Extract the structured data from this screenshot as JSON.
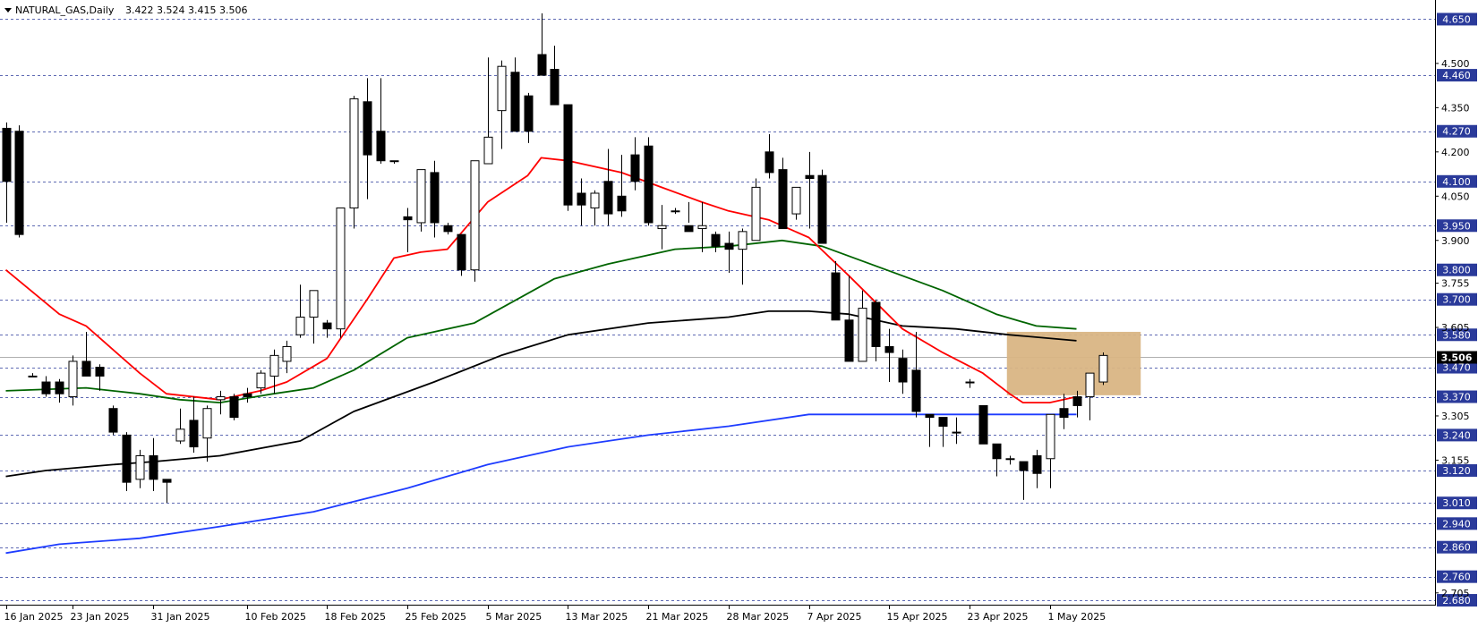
{
  "header": {
    "symbol": "NATURAL_GAS,Daily",
    "ohlc": "3.422 3.524 3.415 3.506",
    "menu_icon": "triangle-down-icon"
  },
  "chart_data": {
    "type": "candlestick",
    "title": "",
    "xlabel": "",
    "ylabel": "",
    "ylim": [
      2.665,
      4.715
    ],
    "grid": "horizontal-dashed",
    "price_levels": [
      4.65,
      4.46,
      4.27,
      4.1,
      3.95,
      3.8,
      3.7,
      3.58,
      3.47,
      3.37,
      3.24,
      3.12,
      3.01,
      2.94,
      2.86,
      2.76,
      2.68
    ],
    "price_ticks": [
      4.5,
      4.35,
      4.2,
      4.05,
      3.9,
      3.755,
      3.605,
      3.305,
      3.155,
      2.705
    ],
    "current_price": "3.506",
    "current_price_value": 3.506,
    "x_labels": [
      {
        "i": 0,
        "label": "16 Jan 2025"
      },
      {
        "i": 5,
        "label": "23 Jan 2025"
      },
      {
        "i": 11,
        "label": "31 Jan 2025"
      },
      {
        "i": 18,
        "label": "10 Feb 2025"
      },
      {
        "i": 24,
        "label": "18 Feb 2025"
      },
      {
        "i": 30,
        "label": "25 Feb 2025"
      },
      {
        "i": 36,
        "label": "5 Mar 2025"
      },
      {
        "i": 42,
        "label": "13 Mar 2025"
      },
      {
        "i": 48,
        "label": "21 Mar 2025"
      },
      {
        "i": 54,
        "label": "28 Mar 2025"
      },
      {
        "i": 60,
        "label": "7 Apr 2025"
      },
      {
        "i": 66,
        "label": "15 Apr 2025"
      },
      {
        "i": 72,
        "label": "23 Apr 2025"
      },
      {
        "i": 78,
        "label": "1 May 2025"
      }
    ],
    "candles": [
      [
        4.28,
        4.3,
        3.96,
        4.1
      ],
      [
        4.27,
        4.29,
        3.91,
        3.92
      ],
      [
        3.44,
        3.45,
        3.44,
        3.44
      ],
      [
        3.42,
        3.44,
        3.37,
        3.38
      ],
      [
        3.42,
        3.43,
        3.35,
        3.38
      ],
      [
        3.37,
        3.51,
        3.34,
        3.49
      ],
      [
        3.49,
        3.59,
        3.44,
        3.44
      ],
      [
        3.47,
        3.48,
        3.39,
        3.44
      ],
      [
        3.33,
        3.34,
        3.24,
        3.25
      ],
      [
        3.24,
        3.25,
        3.05,
        3.08
      ],
      [
        3.09,
        3.19,
        3.06,
        3.17
      ],
      [
        3.17,
        3.23,
        3.05,
        3.09
      ],
      [
        3.09,
        3.09,
        3.01,
        3.08
      ],
      [
        3.22,
        3.33,
        3.21,
        3.26
      ],
      [
        3.29,
        3.37,
        3.18,
        3.2
      ],
      [
        3.23,
        3.34,
        3.15,
        3.33
      ],
      [
        3.36,
        3.39,
        3.31,
        3.37
      ],
      [
        3.37,
        3.38,
        3.29,
        3.3
      ],
      [
        3.38,
        3.4,
        3.35,
        3.37
      ],
      [
        3.4,
        3.46,
        3.38,
        3.45
      ],
      [
        3.44,
        3.53,
        3.38,
        3.51
      ],
      [
        3.49,
        3.56,
        3.45,
        3.54
      ],
      [
        3.58,
        3.75,
        3.57,
        3.64
      ],
      [
        3.64,
        3.71,
        3.55,
        3.73
      ],
      [
        3.62,
        3.63,
        3.57,
        3.6
      ],
      [
        3.6,
        4.01,
        3.57,
        4.01
      ],
      [
        4.01,
        4.39,
        3.94,
        4.38
      ],
      [
        4.37,
        4.45,
        4.04,
        4.19
      ],
      [
        4.27,
        4.45,
        4.16,
        4.17
      ],
      [
        4.17,
        4.17,
        4.16,
        4.17
      ],
      [
        3.98,
        4.01,
        3.86,
        3.97
      ],
      [
        3.96,
        4.14,
        3.93,
        4.14
      ],
      [
        4.13,
        4.17,
        3.91,
        3.96
      ],
      [
        3.95,
        3.96,
        3.92,
        3.93
      ],
      [
        3.92,
        3.92,
        3.78,
        3.8
      ],
      [
        3.8,
        4.17,
        3.76,
        4.17
      ],
      [
        4.16,
        4.52,
        4.17,
        4.25
      ],
      [
        4.34,
        4.51,
        4.21,
        4.49
      ],
      [
        4.47,
        4.52,
        4.31,
        4.27
      ],
      [
        4.39,
        4.4,
        4.23,
        4.27
      ],
      [
        4.53,
        4.67,
        4.46,
        4.46
      ],
      [
        4.48,
        4.56,
        4.36,
        4.36
      ],
      [
        4.36,
        4.36,
        4.0,
        4.02
      ],
      [
        4.06,
        4.11,
        3.95,
        4.02
      ],
      [
        4.01,
        4.07,
        3.95,
        4.06
      ],
      [
        4.1,
        4.21,
        3.95,
        3.99
      ],
      [
        4.05,
        4.19,
        3.98,
        4.0
      ],
      [
        4.19,
        4.25,
        4.07,
        4.1
      ],
      [
        4.22,
        4.25,
        3.95,
        3.96
      ],
      [
        3.94,
        4.02,
        3.87,
        3.95
      ],
      [
        4.0,
        4.01,
        3.99,
        4.0
      ],
      [
        3.95,
        4.03,
        3.96,
        3.93
      ],
      [
        3.94,
        4.03,
        3.86,
        3.95
      ],
      [
        3.92,
        3.93,
        3.86,
        3.88
      ],
      [
        3.89,
        3.93,
        3.79,
        3.87
      ],
      [
        3.87,
        3.94,
        3.75,
        3.93
      ],
      [
        3.9,
        4.11,
        3.9,
        4.08
      ],
      [
        4.2,
        4.26,
        4.11,
        4.13
      ],
      [
        4.14,
        4.18,
        3.96,
        3.94
      ],
      [
        3.99,
        4.08,
        3.97,
        4.08
      ],
      [
        4.12,
        4.2,
        3.94,
        4.11
      ],
      [
        4.12,
        4.14,
        3.94,
        3.89
      ],
      [
        3.79,
        3.83,
        3.63,
        3.63
      ],
      [
        3.63,
        3.78,
        3.5,
        3.49
      ],
      [
        3.49,
        3.73,
        3.52,
        3.67
      ],
      [
        3.69,
        3.7,
        3.49,
        3.54
      ],
      [
        3.54,
        3.6,
        3.42,
        3.52
      ],
      [
        3.5,
        3.53,
        3.38,
        3.42
      ],
      [
        3.46,
        3.59,
        3.3,
        3.32
      ],
      [
        3.31,
        3.31,
        3.2,
        3.3
      ],
      [
        3.3,
        3.3,
        3.2,
        3.27
      ],
      [
        3.25,
        3.3,
        3.21,
        3.25
      ],
      [
        3.42,
        3.43,
        3.4,
        3.42
      ],
      [
        3.34,
        3.34,
        3.21,
        3.21
      ],
      [
        3.21,
        3.21,
        3.1,
        3.16
      ],
      [
        3.16,
        3.17,
        3.14,
        3.16
      ],
      [
        3.15,
        3.15,
        3.02,
        3.12
      ],
      [
        3.17,
        3.19,
        3.06,
        3.11
      ],
      [
        3.16,
        3.31,
        3.06,
        3.31
      ],
      [
        3.33,
        3.38,
        3.26,
        3.3
      ],
      [
        3.37,
        3.39,
        3.3,
        3.34
      ],
      [
        3.37,
        3.44,
        3.29,
        3.45
      ],
      [
        3.42,
        3.52,
        3.41,
        3.51
      ]
    ],
    "ma_red": [
      [
        0,
        3.8
      ],
      [
        4,
        3.65
      ],
      [
        6,
        3.61
      ],
      [
        10,
        3.45
      ],
      [
        12,
        3.38
      ],
      [
        16,
        3.36
      ],
      [
        19,
        3.39
      ],
      [
        21,
        3.42
      ],
      [
        24,
        3.5
      ],
      [
        27,
        3.7
      ],
      [
        29,
        3.84
      ],
      [
        31,
        3.86
      ],
      [
        33,
        3.87
      ],
      [
        36,
        4.03
      ],
      [
        39,
        4.12
      ],
      [
        40,
        4.18
      ],
      [
        42,
        4.17
      ],
      [
        46,
        4.13
      ],
      [
        49,
        4.08
      ],
      [
        52,
        4.03
      ],
      [
        54,
        4.0
      ],
      [
        57,
        3.97
      ],
      [
        60,
        3.91
      ],
      [
        63,
        3.78
      ],
      [
        67,
        3.6
      ],
      [
        70,
        3.52
      ],
      [
        73,
        3.45
      ],
      [
        75,
        3.38
      ],
      [
        76,
        3.35
      ],
      [
        78,
        3.35
      ],
      [
        80,
        3.37
      ]
    ],
    "ma_green": [
      [
        0,
        3.39
      ],
      [
        6,
        3.4
      ],
      [
        10,
        3.38
      ],
      [
        13,
        3.36
      ],
      [
        16,
        3.35
      ],
      [
        20,
        3.38
      ],
      [
        23,
        3.4
      ],
      [
        26,
        3.46
      ],
      [
        30,
        3.57
      ],
      [
        35,
        3.62
      ],
      [
        41,
        3.77
      ],
      [
        45,
        3.82
      ],
      [
        50,
        3.87
      ],
      [
        54,
        3.88
      ],
      [
        58,
        3.9
      ],
      [
        61,
        3.88
      ],
      [
        64,
        3.83
      ],
      [
        70,
        3.73
      ],
      [
        74,
        3.65
      ],
      [
        77,
        3.61
      ],
      [
        80,
        3.6
      ]
    ],
    "ma_black": [
      [
        0,
        3.1
      ],
      [
        3,
        3.12
      ],
      [
        8,
        3.14
      ],
      [
        11,
        3.15
      ],
      [
        16,
        3.17
      ],
      [
        22,
        3.22
      ],
      [
        26,
        3.32
      ],
      [
        32,
        3.42
      ],
      [
        37,
        3.51
      ],
      [
        42,
        3.58
      ],
      [
        48,
        3.62
      ],
      [
        54,
        3.64
      ],
      [
        57,
        3.66
      ],
      [
        60,
        3.66
      ],
      [
        63,
        3.65
      ],
      [
        67,
        3.61
      ],
      [
        71,
        3.6
      ],
      [
        75,
        3.58
      ],
      [
        80,
        3.56
      ]
    ],
    "ma_blue": [
      [
        0,
        2.84
      ],
      [
        4,
        2.87
      ],
      [
        10,
        2.89
      ],
      [
        16,
        2.93
      ],
      [
        23,
        2.98
      ],
      [
        30,
        3.06
      ],
      [
        36,
        3.14
      ],
      [
        42,
        3.2
      ],
      [
        48,
        3.24
      ],
      [
        54,
        3.27
      ],
      [
        60,
        3.31
      ],
      [
        66,
        3.31
      ],
      [
        70,
        3.31
      ],
      [
        75,
        3.31
      ],
      [
        80,
        3.31
      ]
    ],
    "zone": {
      "i_start": 75,
      "i_end": 85,
      "upper": 3.59,
      "lower": 3.375,
      "color": "#D9B584"
    },
    "colors": {
      "red": "#FF0000",
      "green": "#006400",
      "black": "#000000",
      "blue": "#1E3CFF",
      "grid": "#2A3A9A",
      "bull": "#FFFFFF",
      "bear": "#000000"
    }
  }
}
